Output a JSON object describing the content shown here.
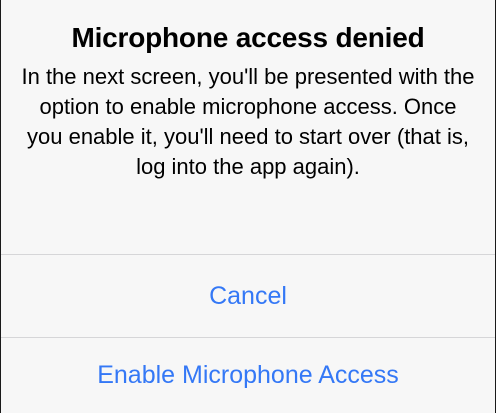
{
  "alert": {
    "title": "Microphone access denied",
    "message": "In the next screen, you'll be presented with the option to enable microphone access. Once you enable it, you'll need to start over (that is, log into the app again).",
    "buttons": [
      {
        "label": "Cancel"
      },
      {
        "label": "Enable Microphone Access"
      }
    ]
  },
  "colors": {
    "action_text": "#3478f6",
    "background": "#f7f7f7",
    "divider": "#d6d6d8"
  }
}
